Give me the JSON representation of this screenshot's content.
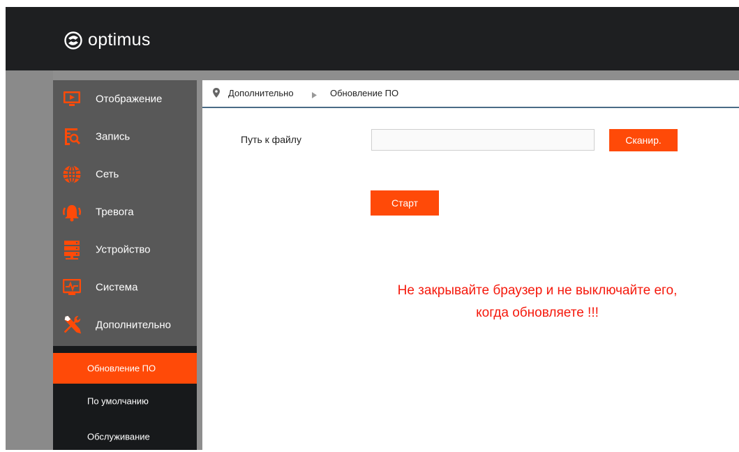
{
  "brand": {
    "name": "optimus"
  },
  "colors": {
    "accent": "#ff4a08",
    "header_bg": "#1e1f21",
    "sidebar_bg": "#585858",
    "submenu_bg": "#17191b",
    "warning": "#f5190c"
  },
  "sidebar": {
    "items": [
      {
        "label": "Отображение",
        "icon": "monitor-play-icon"
      },
      {
        "label": "Запись",
        "icon": "record-search-icon"
      },
      {
        "label": "Сеть",
        "icon": "globe-icon"
      },
      {
        "label": "Тревога",
        "icon": "alarm-bell-icon"
      },
      {
        "label": "Устройство",
        "icon": "storage-device-icon"
      },
      {
        "label": "Система",
        "icon": "system-monitor-icon"
      },
      {
        "label": "Дополнительно",
        "icon": "tools-icon"
      }
    ],
    "submenu": [
      {
        "label": "Обновление ПО",
        "active": true
      },
      {
        "label": "По умолчанию",
        "active": false
      },
      {
        "label": "Обслуживание",
        "active": false
      }
    ]
  },
  "breadcrumb": {
    "parent": "Дополнительно",
    "current": "Обновление ПО"
  },
  "form": {
    "path_label": "Путь к файлу",
    "path_value": "",
    "path_placeholder": "",
    "scan_label": "Сканир.",
    "start_label": "Старт"
  },
  "warning": {
    "line1": "Не закрывайте браузер и не выключайте его,",
    "line2": "когда обновляете !!!"
  }
}
